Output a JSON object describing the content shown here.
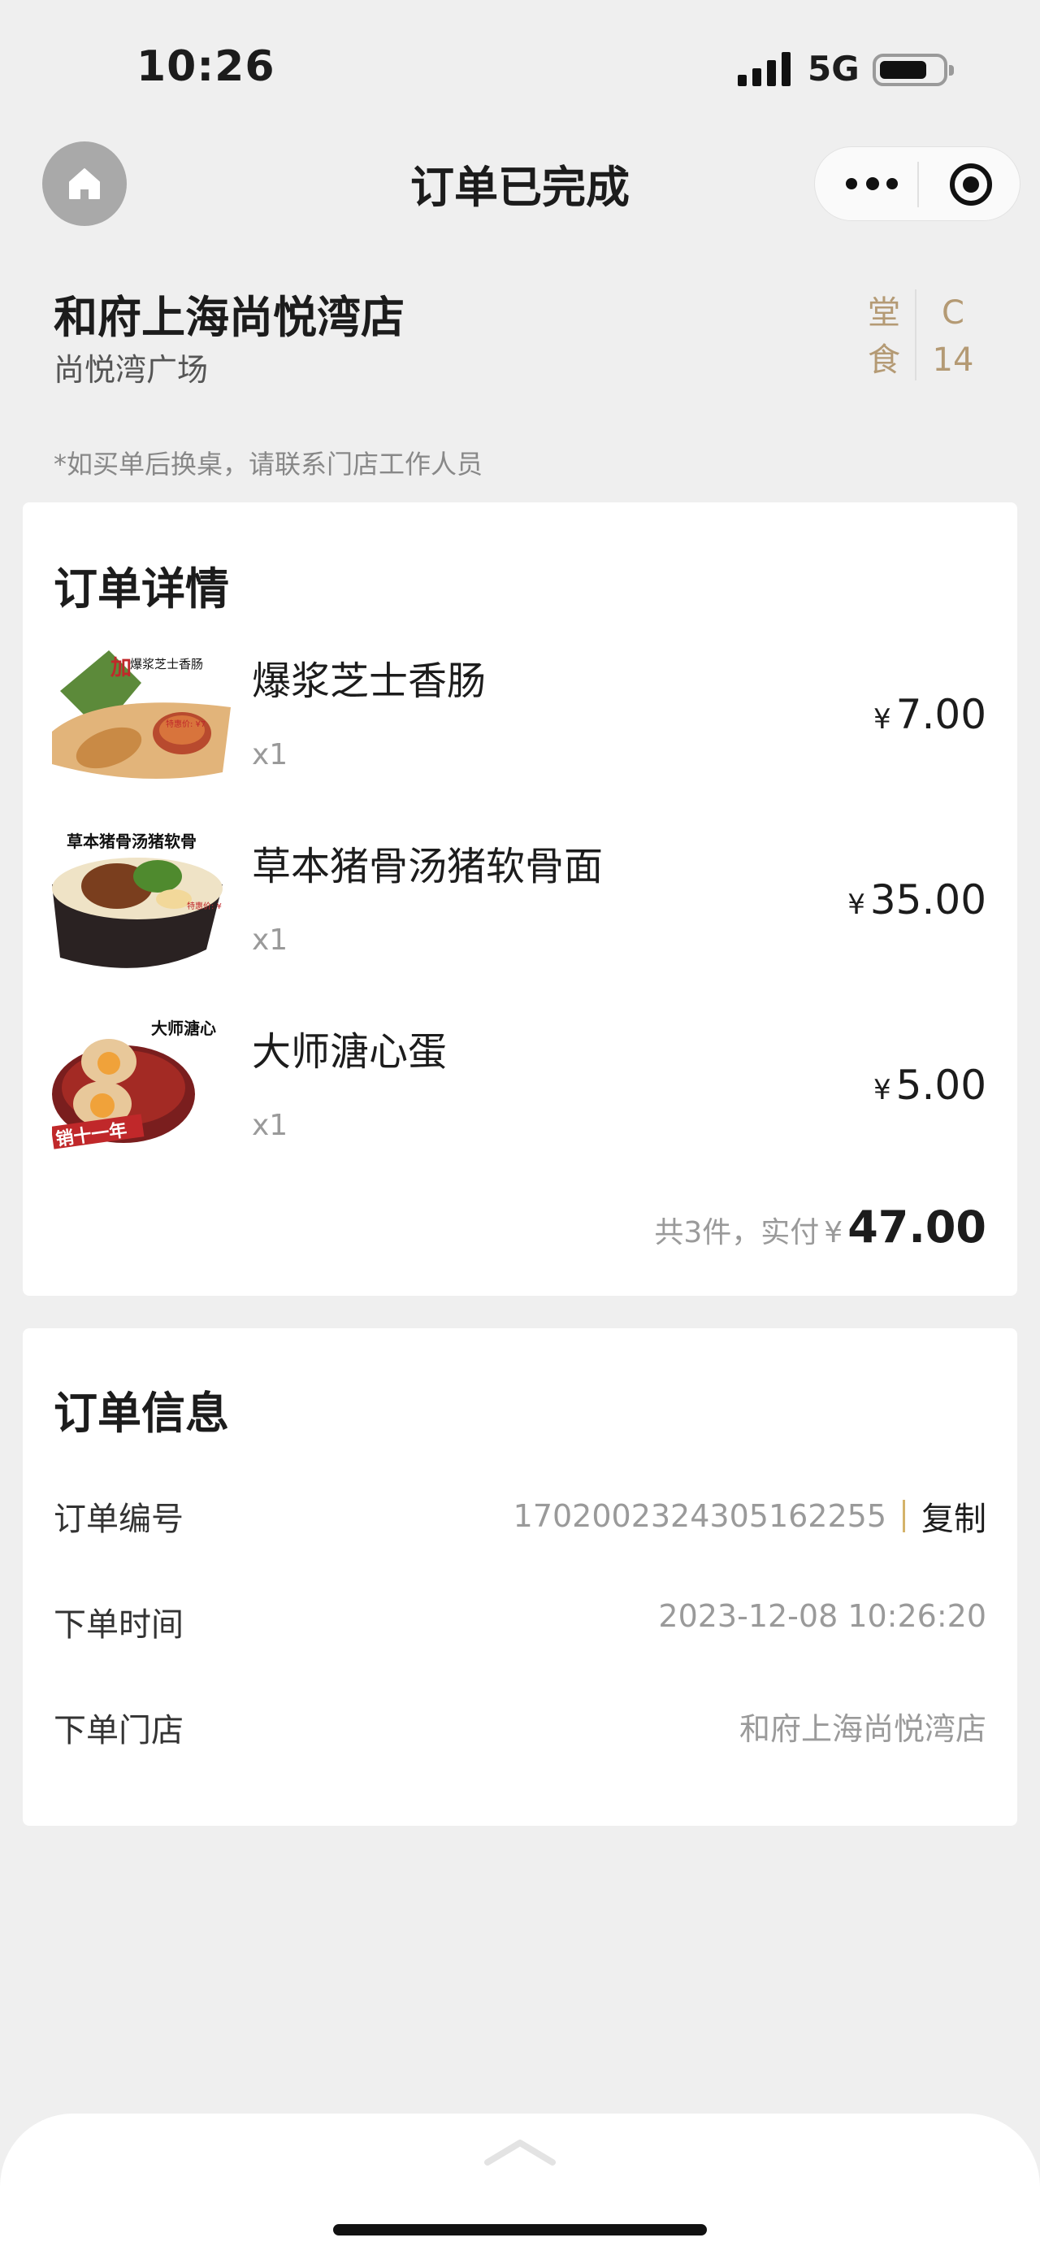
{
  "status_bar": {
    "time": "10:26",
    "network": "5G"
  },
  "nav": {
    "title": "订单已完成",
    "home_icon": "home-icon",
    "more_icon": "more-dots-icon",
    "close_icon": "target-close-icon"
  },
  "store": {
    "name": "和府上海尚悦湾店",
    "location": "尚悦湾广场",
    "dine_type": "堂食",
    "dine_type_top": "堂",
    "dine_type_bottom": "食",
    "table_prefix": "C",
    "table_number": "14"
  },
  "notice": "*如买单后换桌，请联系门店工作人员",
  "order_details": {
    "title": "订单详情",
    "currency": "¥",
    "items": [
      {
        "name": "爆浆芝士香肠",
        "quantity": "x1",
        "price": "7.00",
        "image_text": "爆浆芝士香肠",
        "image_badge": "加",
        "image_price_label": "特惠价: ¥7"
      },
      {
        "name": "草本猪骨汤猪软骨面",
        "quantity": "x1",
        "price": "35.00",
        "image_text": "草本猪骨汤猪软骨",
        "image_price_label": "特惠价: ¥"
      },
      {
        "name": "大师溏心蛋",
        "quantity": "x1",
        "price": "5.00",
        "image_text": "大师溏心",
        "image_banner": "销十一年"
      }
    ],
    "summary_label": "共3件，实付",
    "total": "47.00"
  },
  "order_info": {
    "title": "订单信息",
    "order_number_label": "订单编号",
    "order_number": "1702002324305162255",
    "copy_label": "复制",
    "order_time_label": "下单时间",
    "order_time": "2023-12-08 10:26:20",
    "store_label": "下单门店",
    "store_value": "和府上海尚悦湾店"
  },
  "colors": {
    "background": "#efefef",
    "card": "#ffffff",
    "accent_gold": "#b49a74",
    "copy_divider": "#d4b36a",
    "muted_text": "#9a9a9a"
  }
}
